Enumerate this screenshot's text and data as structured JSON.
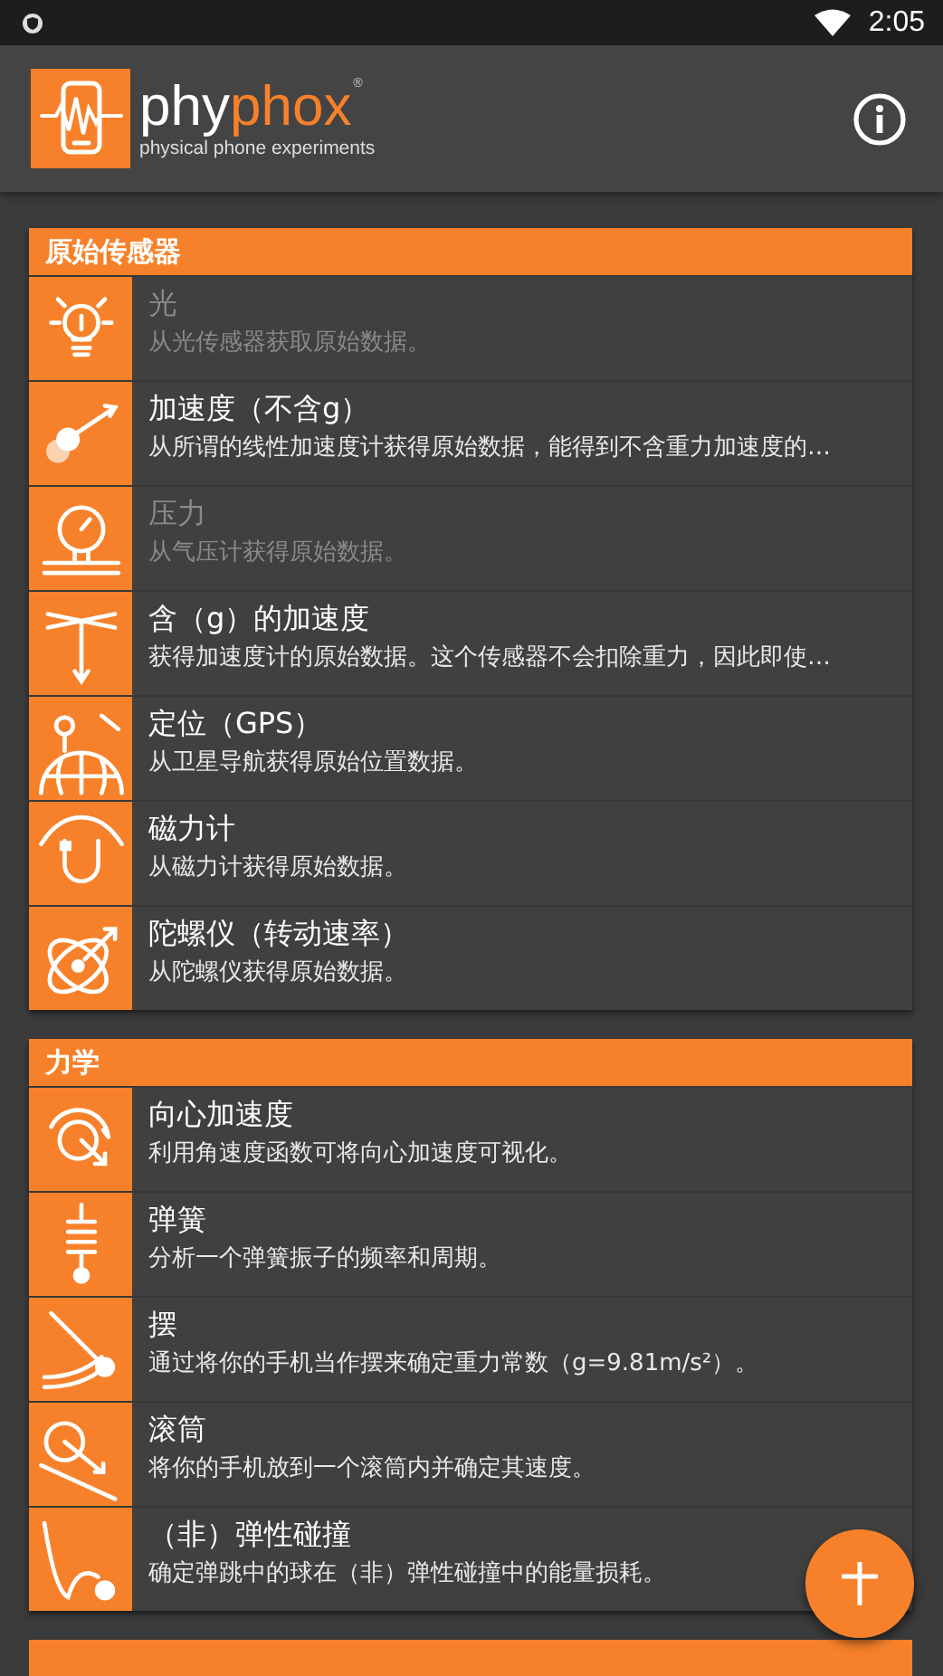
{
  "status_bar": {
    "time": "2:05"
  },
  "app_bar": {
    "logo_dark": "phy",
    "logo_accent": "phox",
    "logo_mark": "®",
    "tagline": "physical phone experiments"
  },
  "sections": [
    {
      "title": "原始传感器",
      "items": [
        {
          "title": "光",
          "description": "从光传感器获取原始数据。",
          "disabled": true
        },
        {
          "title": "加速度（不含g）",
          "description": "从所谓的线性加速度计获得原始数据，能得到不含重力加速度的…",
          "disabled": false
        },
        {
          "title": "压力",
          "description": "从气压计获得原始数据。",
          "disabled": true
        },
        {
          "title": "含（g）的加速度",
          "description": "获得加速度计的原始数据。这个传感器不会扣除重力，因此即使…",
          "disabled": false
        },
        {
          "title": "定位（GPS）",
          "description": "从卫星导航获得原始位置数据。",
          "disabled": false
        },
        {
          "title": "磁力计",
          "description": "从磁力计获得原始数据。",
          "disabled": false
        },
        {
          "title": "陀螺仪（转动速率）",
          "description": "从陀螺仪获得原始数据。",
          "disabled": false
        }
      ]
    },
    {
      "title": "力学",
      "items": [
        {
          "title": "向心加速度",
          "description": "利用角速度函数可将向心加速度可视化。",
          "disabled": false
        },
        {
          "title": "弹簧",
          "description": "分析一个弹簧振子的频率和周期。",
          "disabled": false
        },
        {
          "title": "摆",
          "description": "通过将你的手机当作摆来确定重力常数（g=9.81m/s²）。",
          "disabled": false
        },
        {
          "title": "滚筒",
          "description": "将你的手机放到一个滚筒内并确定其速度。",
          "disabled": false
        },
        {
          "title": "（非）弹性碰撞",
          "description": "确定弹跳中的球在（非）弹性碰撞中的能量损耗。",
          "disabled": false
        }
      ]
    }
  ]
}
